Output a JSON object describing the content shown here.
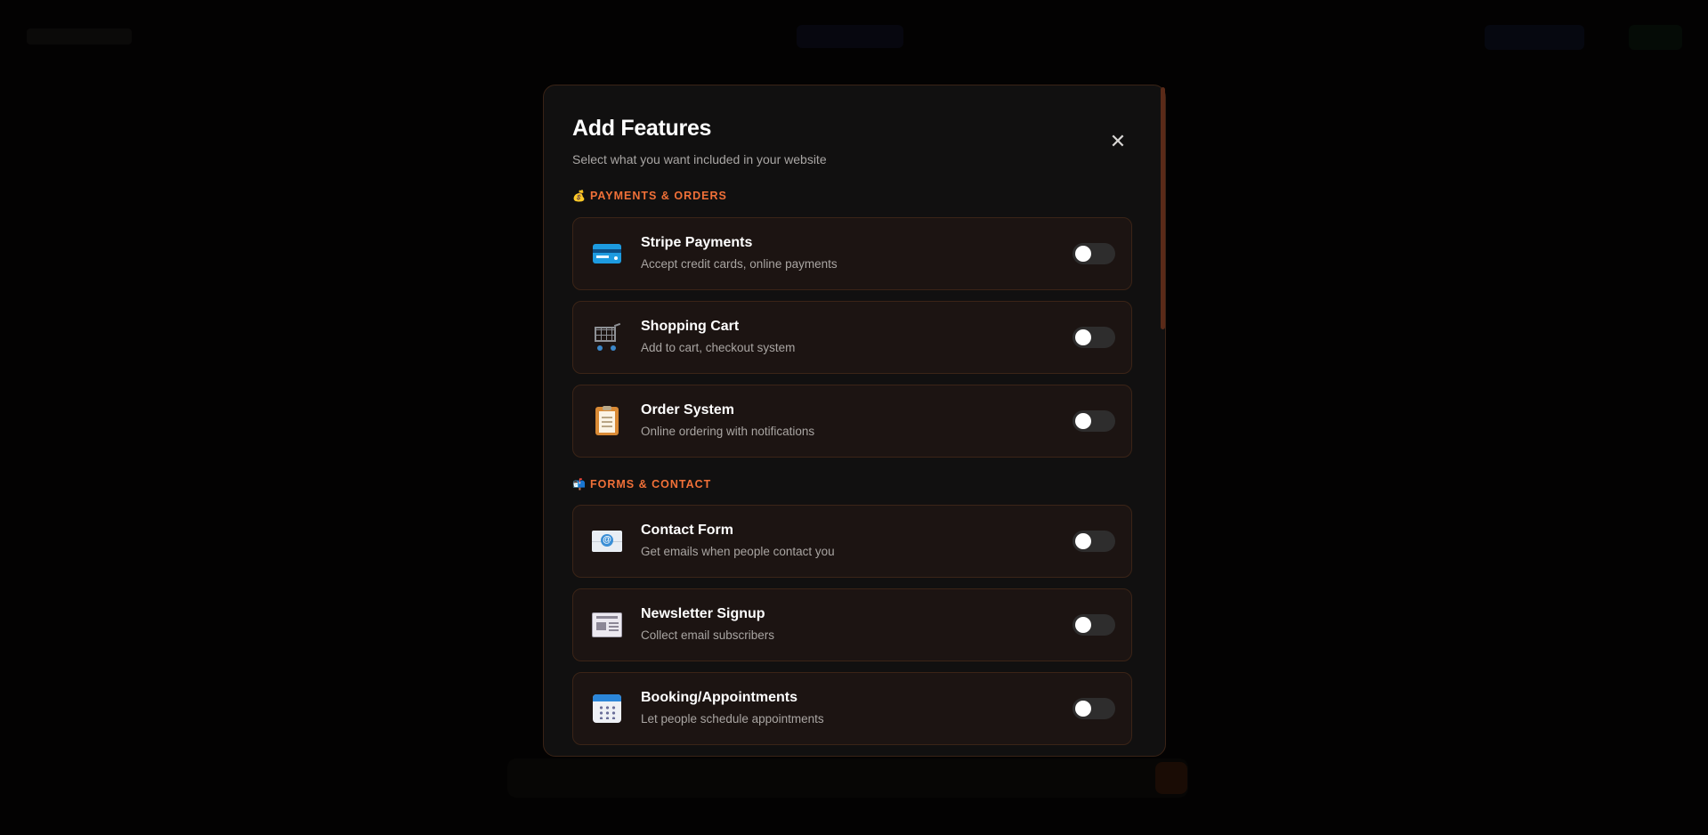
{
  "modal": {
    "title": "Add Features",
    "subtitle": "Select what you want included in your website",
    "close_label": "✕"
  },
  "sections": [
    {
      "icon": "💰",
      "title": "PAYMENTS & ORDERS",
      "items": [
        {
          "icon": "credit-card-icon",
          "title": "Stripe Payments",
          "description": "Accept credit cards, online payments",
          "enabled": false
        },
        {
          "icon": "shopping-cart-icon",
          "title": "Shopping Cart",
          "description": "Add to cart, checkout system",
          "enabled": false
        },
        {
          "icon": "clipboard-icon",
          "title": "Order System",
          "description": "Online ordering with notifications",
          "enabled": false
        }
      ]
    },
    {
      "icon": "📬",
      "title": "FORMS & CONTACT",
      "items": [
        {
          "icon": "email-icon",
          "title": "Contact Form",
          "description": "Get emails when people contact you",
          "enabled": false
        },
        {
          "icon": "newspaper-icon",
          "title": "Newsletter Signup",
          "description": "Collect email subscribers",
          "enabled": false
        },
        {
          "icon": "calendar-icon",
          "title": "Booking/Appointments",
          "description": "Let people schedule appointments",
          "enabled": false
        }
      ]
    }
  ],
  "colors": {
    "accent": "#f07038",
    "card_bg": "#1c1412",
    "card_border": "#3b2417",
    "modal_bg": "#111010"
  }
}
